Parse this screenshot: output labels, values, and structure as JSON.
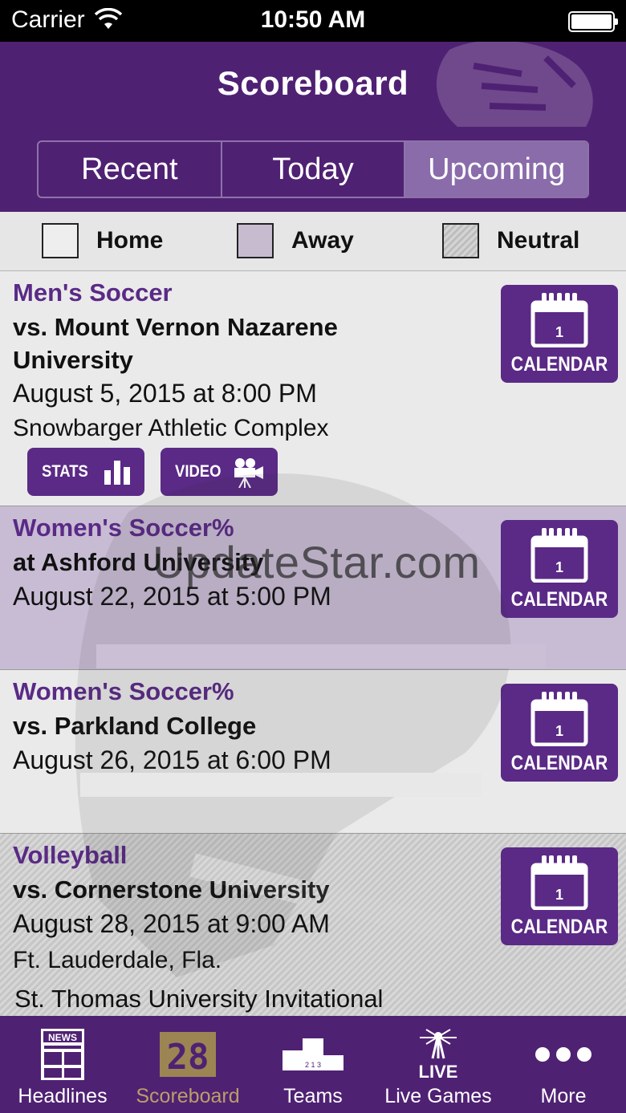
{
  "status_bar": {
    "carrier": "Carrier",
    "time": "10:50 AM"
  },
  "header": {
    "title": "Scoreboard"
  },
  "segments": [
    {
      "label": "Recent",
      "active": false
    },
    {
      "label": "Today",
      "active": false
    },
    {
      "label": "Upcoming",
      "active": true
    }
  ],
  "legend": {
    "home": "Home",
    "away": "Away",
    "neutral": "Neutral"
  },
  "games": [
    {
      "type": "home",
      "sport": "Men's Soccer",
      "opponent": "vs. Mount Vernon Nazarene University",
      "datetime": "August 5, 2015 at 8:00 PM",
      "location": "Snowbarger Athletic Complex",
      "note": "",
      "calendar_label": "CALENDAR",
      "calendar_day": "1",
      "stats_label": "STATS",
      "video_label": "VIDEO"
    },
    {
      "type": "away",
      "sport": "Women's Soccer%",
      "opponent": "at Ashford University",
      "datetime": "August 22, 2015 at 5:00 PM",
      "location": "",
      "note": "",
      "calendar_label": "CALENDAR",
      "calendar_day": "1"
    },
    {
      "type": "home",
      "sport": "Women's Soccer%",
      "opponent": "vs. Parkland College",
      "datetime": "August 26, 2015 at 6:00 PM",
      "location": "",
      "note": "",
      "calendar_label": "CALENDAR",
      "calendar_day": "1"
    },
    {
      "type": "neutral",
      "sport": "Volleyball",
      "opponent": "vs. Cornerstone University",
      "datetime": "August 28, 2015 at 9:00 AM",
      "location": "Ft. Lauderdale, Fla.",
      "note": "St. Thomas University Invitational",
      "calendar_label": "CALENDAR",
      "calendar_day": "1"
    }
  ],
  "watermark": "UpdateStar.com",
  "tabs": [
    {
      "label": "Headlines",
      "icon": "newspaper-icon",
      "active": false,
      "icon_text": "NEWS"
    },
    {
      "label": "Scoreboard",
      "icon": "scoreboard-icon",
      "active": true,
      "icon_text": "28"
    },
    {
      "label": "Teams",
      "icon": "podium-icon",
      "active": false,
      "icon_text": "2 1 3"
    },
    {
      "label": "Live Games",
      "icon": "live-broadcast-icon",
      "active": false,
      "icon_text": "LIVE"
    },
    {
      "label": "More",
      "icon": "more-dots-icon",
      "active": false
    }
  ],
  "colors": {
    "brand_purple": "#4f2173",
    "button_purple": "#5a2a86",
    "active_tab": "#b89f6a",
    "away_row": "#c4b6d2"
  }
}
